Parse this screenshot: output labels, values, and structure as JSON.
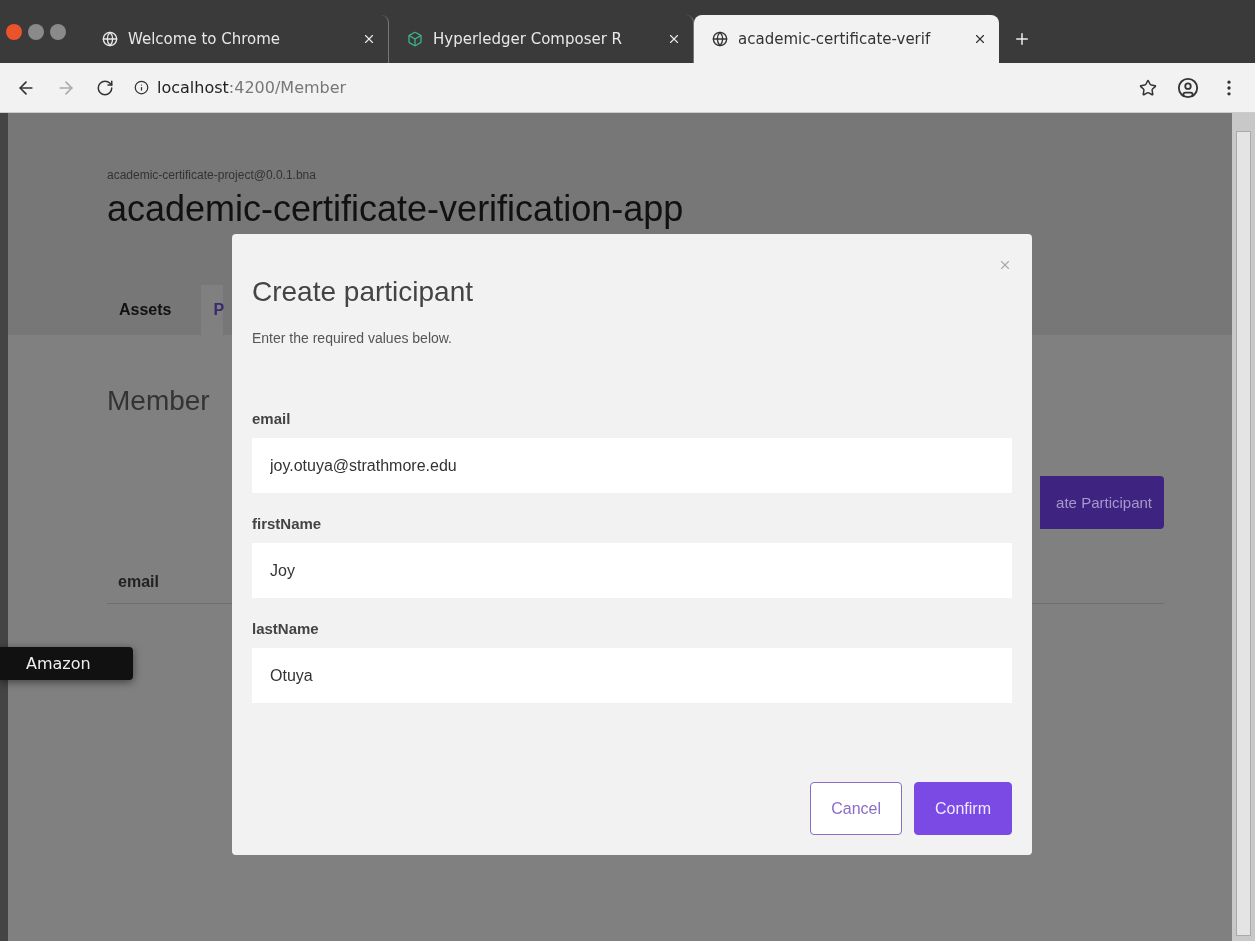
{
  "browser": {
    "tabs": [
      {
        "title": "Welcome to Chrome",
        "kind": "globe",
        "selected": false
      },
      {
        "title": "Hyperledger Composer R",
        "kind": "cube",
        "selected": false
      },
      {
        "title": "academic-certificate-verif",
        "kind": "globe",
        "selected": true
      }
    ],
    "address": {
      "host": "localhost",
      "rest": ":4200/Member"
    },
    "forward_disabled": true
  },
  "page": {
    "project": "academic-certificate-project@0.0.1.bna",
    "title": "academic-certificate-verification-app",
    "tabs": [
      {
        "label": "Assets",
        "selected": false
      },
      {
        "label": "P",
        "selected": true
      }
    ],
    "heading": "Member",
    "create_button": "ate Participant",
    "table_columns": [
      "email"
    ]
  },
  "tooltip": "Amazon",
  "modal": {
    "title": "Create participant",
    "subtitle": "Enter the required values below.",
    "fields": [
      {
        "label": "email",
        "value": "joy.otuya@strathmore.edu"
      },
      {
        "label": "firstName",
        "value": "Joy"
      },
      {
        "label": "lastName",
        "value": "Otuya"
      }
    ],
    "buttons": [
      {
        "label": "Cancel",
        "kind": "secondary"
      },
      {
        "label": "Confirm",
        "kind": "primary"
      }
    ]
  }
}
